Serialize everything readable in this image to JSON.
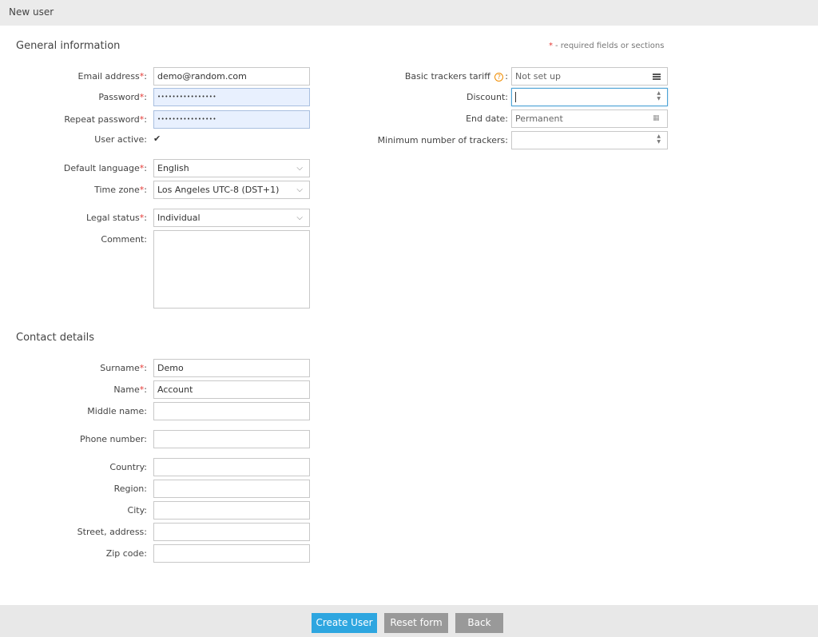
{
  "header": {
    "title": "New user"
  },
  "required_note": {
    "star": "*",
    "text": "- required fields or sections"
  },
  "general": {
    "title": "General information",
    "email": {
      "label": "Email address",
      "value": "demo@random.com"
    },
    "password": {
      "label": "Password",
      "value": "••••••••••••••••"
    },
    "repeat_password": {
      "label": "Repeat password",
      "value": "••••••••••••••••"
    },
    "user_active": {
      "label": "User active:",
      "checked": true,
      "mark": "✔"
    },
    "language": {
      "label": "Default language",
      "value": "English"
    },
    "timezone": {
      "label": "Time zone",
      "value": "Los Angeles UTC-8 (DST+1)"
    },
    "legal_status": {
      "label": "Legal status",
      "value": "Individual"
    },
    "comment": {
      "label": "Comment:",
      "value": ""
    },
    "tariff": {
      "label": "Basic trackers tariff",
      "help": "?",
      "value": "Not set up"
    },
    "discount": {
      "label": "Discount:",
      "value": ""
    },
    "end_date": {
      "label": "End date:",
      "value": "Permanent"
    },
    "min_trackers": {
      "label": "Minimum number of trackers:",
      "value": ""
    }
  },
  "contact": {
    "title": "Contact details",
    "surname": {
      "label": "Surname",
      "value": "Demo"
    },
    "name": {
      "label": "Name",
      "value": "Account"
    },
    "middle_name": {
      "label": "Middle name:",
      "value": ""
    },
    "phone": {
      "label": "Phone number:",
      "value": ""
    },
    "country": {
      "label": "Country:",
      "value": ""
    },
    "region": {
      "label": "Region:",
      "value": ""
    },
    "city": {
      "label": "City:",
      "value": ""
    },
    "street": {
      "label": "Street, address:",
      "value": ""
    },
    "zip": {
      "label": "Zip code:",
      "value": ""
    }
  },
  "footer": {
    "create_label": "Create User",
    "reset_label": "Reset form",
    "back_label": "Back"
  },
  "colors": {
    "accent": "#2ea6e0",
    "required": "#e53935",
    "help": "#f08c00",
    "button_gray": "#999999"
  },
  "icons": {
    "dropdown": "chevron-down-icon",
    "tariff": "menu-icon",
    "date": "calendar-icon",
    "spinner": "spinner-icon"
  }
}
